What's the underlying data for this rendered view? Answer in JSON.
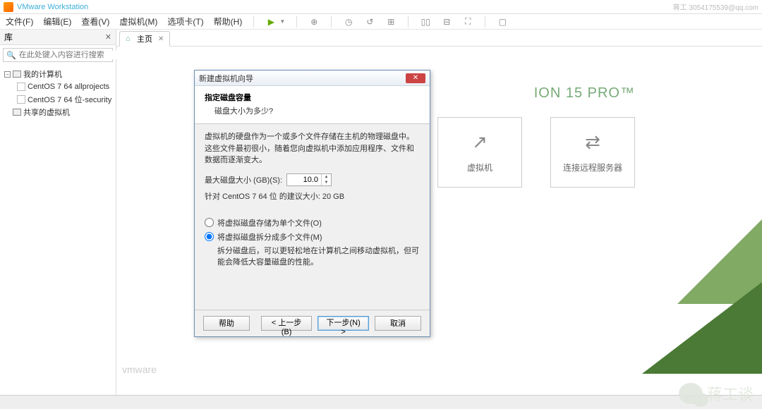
{
  "title": "VMware Workstation",
  "watermark": "蒋工 3054175539@qq.com",
  "menu": {
    "file": "文件(F)",
    "edit": "编辑(E)",
    "view": "查看(V)",
    "vm": "虚拟机(M)",
    "tabs": "选项卡(T)",
    "help": "帮助(H)"
  },
  "sidebar": {
    "title": "库",
    "search_placeholder": "在此处键入内容进行搜索",
    "items": {
      "root": "我的计算机",
      "vm1": "CentOS 7 64 allprojects",
      "vm2": "CentOS 7 64 位-security",
      "shared": "共享的虚拟机"
    }
  },
  "tabs": {
    "home": "主页"
  },
  "brand_text": "vmware",
  "home": {
    "pro_title": "ION 15 PRO™",
    "card1": "虚拟机",
    "card2": "连接远程服务器"
  },
  "dialog": {
    "title": "新建虚拟机向导",
    "heading": "指定磁盘容量",
    "subheading": "磁盘大小为多少?",
    "desc": "虚拟机的硬盘作为一个或多个文件存储在主机的物理磁盘中。这些文件最初很小，随着您向虚拟机中添加应用程序、文件和数据而逐渐变大。",
    "size_label": "最大磁盘大小 (GB)(S):",
    "size_value": "10.0",
    "recommend": "针对 CentOS 7 64 位 的建议大小: 20 GB",
    "radio_single": "将虚拟磁盘存储为单个文件(O)",
    "radio_split": "将虚拟磁盘拆分成多个文件(M)",
    "split_hint": "拆分磁盘后，可以更轻松地在计算机之间移动虚拟机，但可能会降低大容量磁盘的性能。",
    "help": "帮助",
    "back": "< 上一步(B)",
    "next": "下一步(N) >",
    "cancel": "取消"
  },
  "wechat_label": "蒋工谈"
}
